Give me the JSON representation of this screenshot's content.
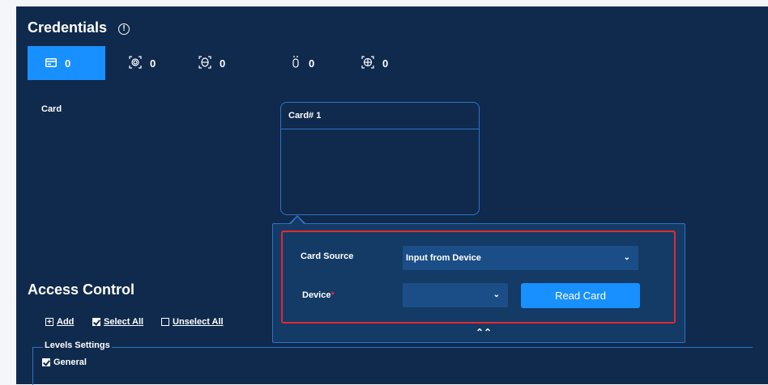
{
  "credentials": {
    "title": "Credentials",
    "info_icon": "info-icon",
    "tabs": [
      {
        "icon": "card-icon",
        "count": "0",
        "active": true
      },
      {
        "icon": "fingerprint-icon",
        "count": "0",
        "active": false
      },
      {
        "icon": "face-icon",
        "count": "0",
        "active": false
      },
      {
        "icon": "hand-icon",
        "count": "0",
        "active": false
      },
      {
        "icon": "iris-icon",
        "count": "0",
        "active": false
      }
    ],
    "card_label": "Card",
    "card_box_title": "Card# 1"
  },
  "popup": {
    "card_source_label": "Card Source",
    "card_source_value": "Input from Device",
    "device_label": "Device",
    "device_required_mark": "*",
    "device_value": "",
    "read_card_button": "Read Card",
    "collapse_icon": "double-chevron-up-icon"
  },
  "access_control": {
    "title": "Access Control",
    "add_label": "Add",
    "select_all_label": "Select All",
    "select_all_checked": true,
    "unselect_all_label": "Unselect All",
    "unselect_all_checked": false,
    "levels_settings_label": "Levels Settings",
    "levels": [
      {
        "label": "General",
        "checked": true
      }
    ]
  },
  "colors": {
    "background": "#0f2a4c",
    "accent": "#1890ff",
    "popup": "#143a66",
    "highlight_frame": "#e4292f"
  }
}
